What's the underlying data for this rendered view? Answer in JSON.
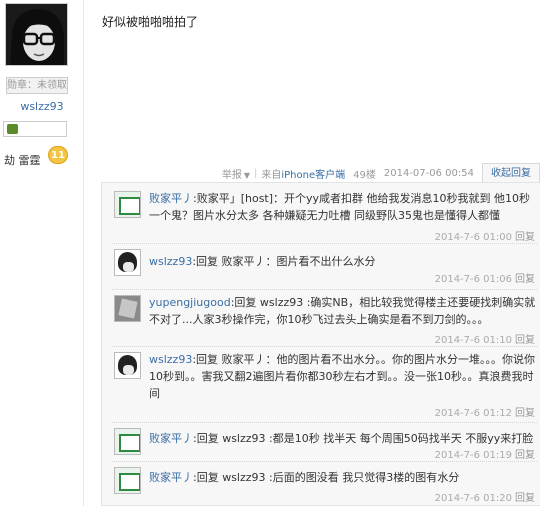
{
  "user": {
    "medal_label": "勋章：未领取",
    "name": "wslzz93",
    "rank": "劫 雷霆",
    "level": "11"
  },
  "post": {
    "text": "好似被啪啪啪拍了",
    "report": "举报",
    "source": "来自iPhone客户端",
    "floor": "49楼",
    "timestamp": "2014-07-06 00:54",
    "collapse_reply": "收起回复"
  },
  "replies": [
    {
      "author": "败家平丿",
      "text": ":败家平」[host]：开个yy咸者扣群 他给我发消息10秒我就到 他10秒一个鬼？图片水分太多 各种嫌疑无力吐槽 同级野队35鬼也是懂得人都懂",
      "time": "2014-7-6 01:00",
      "reply_label": "回复",
      "avatar_icon": "green-avatar-icon"
    },
    {
      "author": "wslzz93",
      "text": ":回复 败家平丿：图片看不出什么水分",
      "time": "2014-7-6 01:06",
      "reply_label": "回复",
      "avatar_icon": "dark-avatar-icon"
    },
    {
      "author": "yupengjiugood",
      "text": ":回复 wslzz93 :确实NB，相比较我觉得楼主还要硬找刺确实就不对了...人家3秒操作完，你10秒飞过去头上确实是看不到刀剑的。。。",
      "time": "2014-7-6 01:10",
      "reply_label": "回复",
      "avatar_icon": "gray-avatar-icon"
    },
    {
      "author": "wslzz93",
      "text": ":回复 败家平丿：他的图片看不出水分。。你的图片水分一堆。。。你说你10秒到。。害我又翻2遍图片看你都30秒左右才到。。没一张10秒。。真浪费我时间",
      "time": "2014-7-6 01:12",
      "reply_label": "回复",
      "avatar_icon": "dark-avatar-icon"
    },
    {
      "author": "败家平丿",
      "text": ":回复 wslzz93 :都是10秒 找半天 每个周围50码找半天 不服yy来打脸",
      "time": "2014-7-6 01:19",
      "reply_label": "回复",
      "avatar_icon": "green-avatar-icon"
    },
    {
      "author": "败家平丿",
      "text": ":回复 wslzz93 :后面的图没看 我只觉得3楼的图有水分",
      "time": "2014-7-6 01:20",
      "reply_label": "回复",
      "avatar_icon": "green-avatar-icon"
    }
  ]
}
